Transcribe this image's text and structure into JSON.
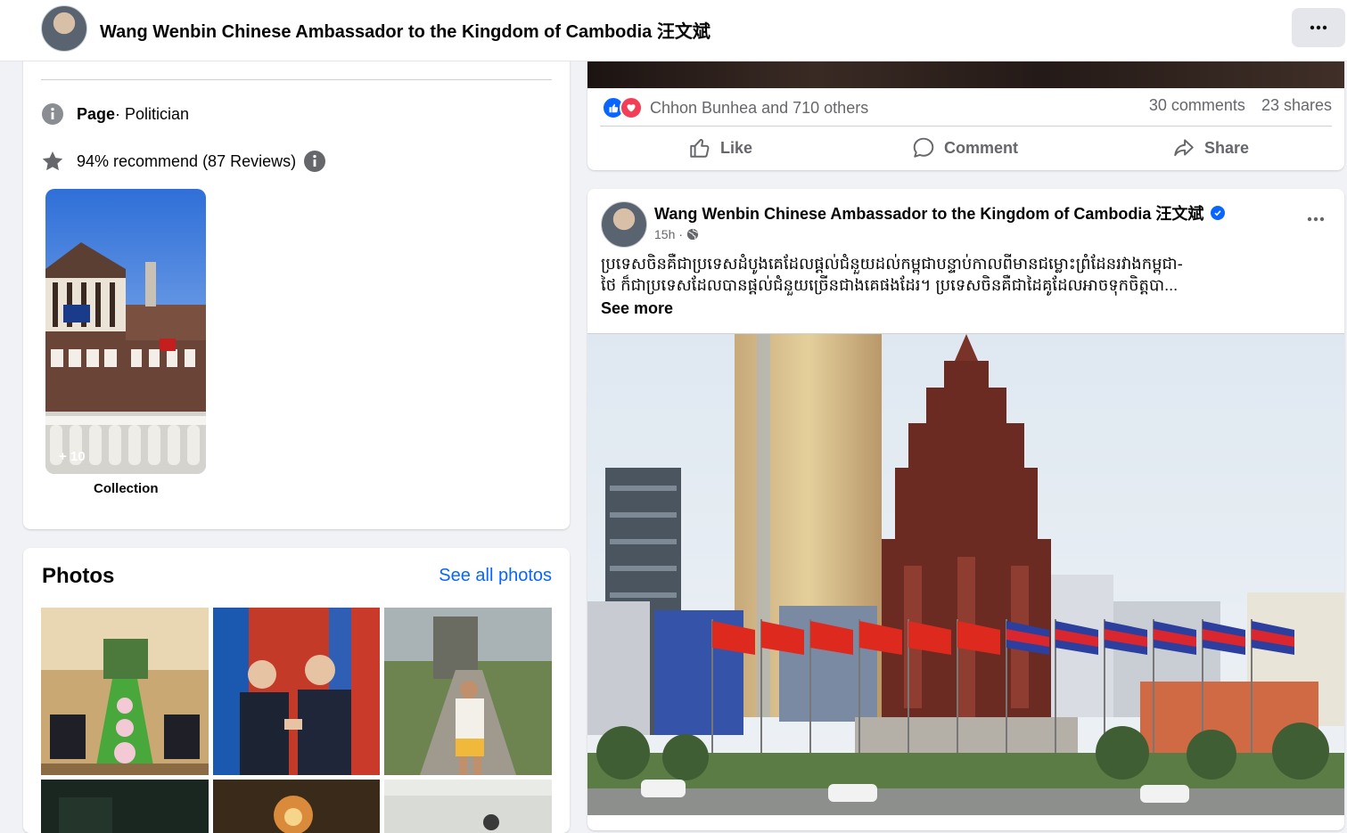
{
  "header": {
    "page_name": "Wang Wenbin Chinese Ambassador to the Kingdom of Cambodia 汪文斌",
    "more_icon": "ellipsis-icon"
  },
  "intro": {
    "category_label": "Page",
    "category_value": " · Politician",
    "rating_text": "94% recommend (87 Reviews)",
    "collection_count": "+ 10",
    "collection_label": "Collection"
  },
  "photos": {
    "title": "Photos",
    "see_all": "See all photos"
  },
  "post1": {
    "reactions_text": "Chhon Bunhea and 710 others",
    "comments": "30 comments",
    "shares": "23 shares",
    "actions": {
      "like": "Like",
      "comment": "Comment",
      "share": "Share"
    }
  },
  "post2": {
    "author": "Wang Wenbin Chinese Ambassador to the Kingdom of Cambodia 汪文斌",
    "time": "15h",
    "privacy_icon": "globe-icon",
    "text_line1": "ប្រទេសចិនគឺជាប្រទេសដំបូងគេដែលផ្តល់ជំនួយដល់កម្ពុជាបន្ទាប់កាលពីមានជម្លោះព្រំដែនរវាងកម្ពុជា-",
    "text_line2": "ថៃ ក៏ជាប្រទេសដែលបានផ្តល់ជំនួយច្រើនជាងគេផងដែរ។ ប្រទេសចិនគឺជាដៃគូដែលអាចទុកចិត្តបា...",
    "see_more": "See more"
  },
  "colors": {
    "accent": "#0866ff",
    "background": "#f0f2f5",
    "secondary_text": "#65676b"
  }
}
